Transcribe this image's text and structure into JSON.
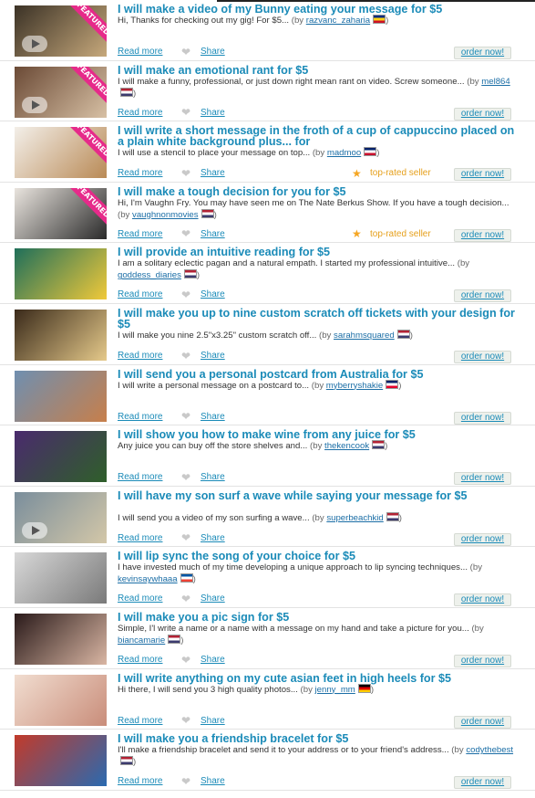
{
  "actions": {
    "read_more": "Read more",
    "share": "Share",
    "order_now": "order now!",
    "featured": "FEATURED",
    "top_rated": "top-rated seller",
    "by": "by"
  },
  "gigs": [
    {
      "title": "I will make a video of my Bunny eating your message for $5",
      "desc": "Hi, Thanks for checking out my gig! For $5...",
      "user": "razvanc_zaharia",
      "flag": [
        "#002b7f",
        "#fcd116",
        "#ce1126"
      ],
      "featured": true,
      "video": true,
      "top_rated": false,
      "title_lines": 1,
      "thumb_colors": [
        "#3b3226",
        "#c6a87b"
      ]
    },
    {
      "title": "I will make an emotional rant for $5",
      "desc": "I will make a funny, professional, or just down right mean rant on video. Screw someone...",
      "user": "mel864",
      "flag": [
        "#b22234",
        "#ffffff",
        "#3c3b6e"
      ],
      "featured": true,
      "video": true,
      "top_rated": false,
      "title_lines": 1,
      "thumb_colors": [
        "#6b4a36",
        "#d7c0a4"
      ]
    },
    {
      "title": "I will write a short message in the froth of a cup of cappuccino placed on a plain white background plus... for",
      "desc": "I will use a stencil to place your message on top...",
      "user": "madmoo",
      "flag": [
        "#012169",
        "#ffffff",
        "#c8102e"
      ],
      "featured": true,
      "video": false,
      "top_rated": true,
      "title_lines": 2,
      "thumb_colors": [
        "#f3efe9",
        "#b98a56"
      ]
    },
    {
      "title": "I will make a tough decision for you for $5",
      "desc": "Hi, I'm Vaughn Fry. You may have seen me on The Nate Berkus Show. If you have a tough decision...",
      "user": "vaughnonmovies",
      "flag": [
        "#b22234",
        "#ffffff",
        "#3c3b6e"
      ],
      "featured": true,
      "video": false,
      "top_rated": true,
      "title_lines": 1,
      "thumb_colors": [
        "#e9e4de",
        "#2a2a2a"
      ]
    },
    {
      "title": "I will provide an intuitive reading for $5",
      "desc": "I am a solitary eclectic pagan and a natural empath. I started my professional intuitive...",
      "user": "goddess_diaries",
      "flag": [
        "#b22234",
        "#ffffff",
        "#3c3b6e"
      ],
      "featured": false,
      "video": false,
      "top_rated": false,
      "title_lines": 1,
      "thumb_colors": [
        "#1f6f5a",
        "#f0c93a"
      ]
    },
    {
      "title": "I will make you up to nine custom scratch off tickets with your design for $5",
      "desc": "I will make you nine 2.5\"x3.25\" custom scratch off...",
      "user": "sarahmsquared",
      "flag": [
        "#b22234",
        "#ffffff",
        "#3c3b6e"
      ],
      "featured": false,
      "video": false,
      "top_rated": false,
      "title_lines": 2,
      "thumb_colors": [
        "#3a2a1a",
        "#e5c98a"
      ]
    },
    {
      "title": "I will send you a personal postcard from Australia for $5",
      "desc": "I will write a personal message on a postcard to...",
      "user": "myberryshakie",
      "flag": [
        "#012169",
        "#ffffff",
        "#e4002b"
      ],
      "featured": false,
      "video": false,
      "top_rated": false,
      "title_lines": 1,
      "thumb_colors": [
        "#6f8fb0",
        "#c77f4b"
      ]
    },
    {
      "title": "I will show you how to make wine from any juice for $5",
      "desc": "Any juice you can buy off the store shelves and...",
      "user": "thekencook",
      "flag": [
        "#b22234",
        "#ffffff",
        "#3c3b6e"
      ],
      "featured": false,
      "video": false,
      "top_rated": false,
      "title_lines": 1,
      "thumb_colors": [
        "#4a2a6d",
        "#2f5f2a"
      ]
    },
    {
      "title": "I will have my son surf a wave while saying your message for $5",
      "desc": "I will send you a video of my son surfing a wave...",
      "user": "superbeachkid",
      "flag": [
        "#b22234",
        "#ffffff",
        "#3c3b6e"
      ],
      "featured": false,
      "video": true,
      "top_rated": false,
      "title_lines": 2,
      "thumb_colors": [
        "#7a8e9c",
        "#d3c7a8"
      ]
    },
    {
      "title": "I will lip sync the song of your choice for $5",
      "desc": "I have invested much of my time developing a unique approach to lip syncing techniques...",
      "user": "kevinsaywhaaa",
      "flag": [
        "#0055a4",
        "#ffffff",
        "#ef4135"
      ],
      "featured": false,
      "video": false,
      "top_rated": false,
      "title_lines": 1,
      "thumb_colors": [
        "#d8d8d8",
        "#7a7a7a"
      ]
    },
    {
      "title": "I will make you a pic sign for $5",
      "desc": "Simple, I'l write a name or a name with a message on my hand and take a picture for you...",
      "user": "biancamarie",
      "flag": [
        "#b22234",
        "#ffffff",
        "#3c3b6e"
      ],
      "featured": false,
      "video": false,
      "top_rated": false,
      "title_lines": 1,
      "thumb_colors": [
        "#2a1a1a",
        "#d9b6a3"
      ]
    },
    {
      "title": "I will write anything on my cute asian feet in high heels for $5",
      "desc": "Hi there, I will send you 3 high quality photos...",
      "user": "jenny_mm",
      "flag": [
        "#000000",
        "#dd0000",
        "#ffce00"
      ],
      "featured": false,
      "video": false,
      "top_rated": false,
      "title_lines": 1,
      "thumb_colors": [
        "#f1ddd0",
        "#c98d7a"
      ]
    },
    {
      "title": "I will make you a friendship bracelet for $5",
      "desc": "I'll make a friendship bracelet and send it to your address or to your friend's address...",
      "user": "codythebest",
      "flag": [
        "#b22234",
        "#ffffff",
        "#3c3b6e"
      ],
      "featured": false,
      "video": false,
      "top_rated": false,
      "title_lines": 1,
      "thumb_colors": [
        "#c23a2a",
        "#2a6ab0"
      ]
    }
  ]
}
